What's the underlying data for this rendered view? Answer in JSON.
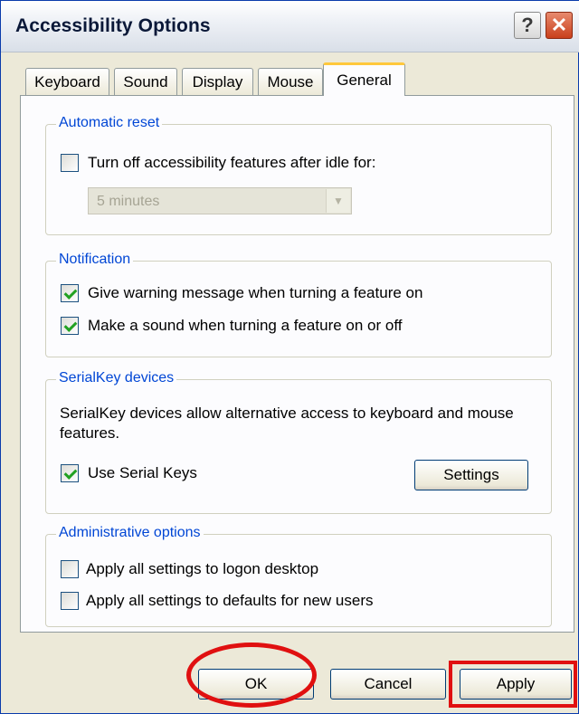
{
  "window": {
    "title": "Accessibility Options",
    "help_glyph": "?",
    "close_glyph": "✕"
  },
  "tabs": [
    {
      "label": "Keyboard",
      "active": false
    },
    {
      "label": "Sound",
      "active": false
    },
    {
      "label": "Display",
      "active": false
    },
    {
      "label": "Mouse",
      "active": false
    },
    {
      "label": "General",
      "active": true
    }
  ],
  "automatic_reset": {
    "legend": "Automatic reset",
    "idle_checkbox": {
      "label": "Turn off accessibility features after idle for:",
      "checked": false
    },
    "idle_select": {
      "value": "5 minutes",
      "disabled": true
    }
  },
  "notification": {
    "legend": "Notification",
    "warning_checkbox": {
      "label": "Give warning message when turning a feature on",
      "checked": true
    },
    "sound_checkbox": {
      "label": "Make a sound when turning a feature on or off",
      "checked": true
    }
  },
  "serialkey": {
    "legend": "SerialKey devices",
    "description": "SerialKey devices allow alternative access to keyboard and mouse features.",
    "use_checkbox": {
      "label": "Use Serial Keys",
      "checked": true
    },
    "settings_button": "Settings"
  },
  "administrative": {
    "legend": "Administrative options",
    "logon_checkbox": {
      "label": "Apply all settings to logon desktop",
      "checked": false
    },
    "defaults_checkbox": {
      "label": "Apply all settings to defaults for new users",
      "checked": false
    }
  },
  "buttons": {
    "ok": "OK",
    "cancel": "Cancel",
    "apply": "Apply"
  },
  "highlight_color": "#e01010"
}
